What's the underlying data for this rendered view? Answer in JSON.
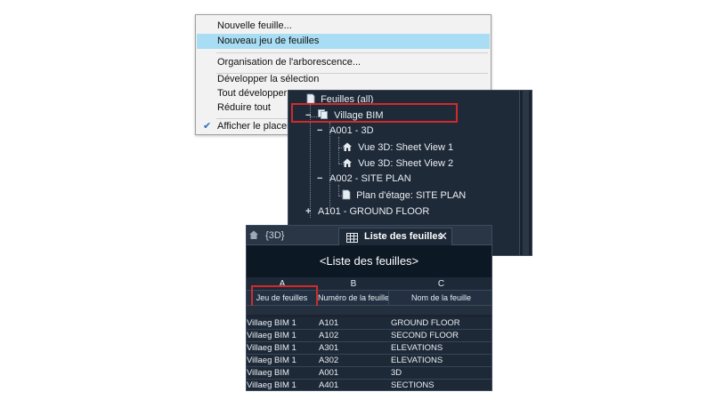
{
  "context_menu": {
    "items": [
      {
        "label": "Nouvelle feuille..."
      },
      {
        "label": "Nouveau jeu de feuilles"
      },
      {
        "label": "Organisation de l'arborescence..."
      },
      {
        "label": "Développer la sélection"
      },
      {
        "label": "Tout développer"
      },
      {
        "label": "Réduire tout"
      },
      {
        "label": "Afficher le placeme"
      }
    ],
    "checkmark": "✔",
    "highlight_color": "#a9ddf3"
  },
  "tree": {
    "root": {
      "label": "Feuilles (all)"
    },
    "sheet_set": {
      "label": "Village BIM",
      "toggle": "−"
    },
    "sheets": [
      {
        "label": "A001 - 3D",
        "toggle": "−",
        "views": [
          "Vue 3D: Sheet View 1",
          "Vue 3D: Sheet View 2"
        ]
      },
      {
        "label": "A002 - SITE PLAN",
        "toggle": "−",
        "views": [
          "Plan d'étage: SITE PLAN"
        ]
      },
      {
        "label": "A101 - GROUND FLOOR",
        "toggle": "+",
        "views": []
      }
    ],
    "highlight_color": "#d22a2a"
  },
  "sheet_list": {
    "tabs": {
      "inactive": "{3D}",
      "active": "Liste des feuilles",
      "close": "✕"
    },
    "title": "<Liste des feuilles>",
    "column_letters": [
      "A",
      "B",
      "C"
    ],
    "columns": [
      "Jeu de feuilles",
      "Numéro de la feuille",
      "Nom de la feuille"
    ],
    "rows": [
      [
        "Villaeg BIM 1",
        "A101",
        "GROUND FLOOR"
      ],
      [
        "Villaeg BIM 1",
        "A102",
        "SECOND FLOOR"
      ],
      [
        "Villaeg BIM 1",
        "A301",
        "ELEVATIONS"
      ],
      [
        "Villaeg BIM 1",
        "A302",
        "ELEVATIONS"
      ],
      [
        "Villaeg BIM",
        "A001",
        "3D"
      ],
      [
        "Villaeg BIM 1",
        "A401",
        "SECTIONS"
      ]
    ]
  }
}
